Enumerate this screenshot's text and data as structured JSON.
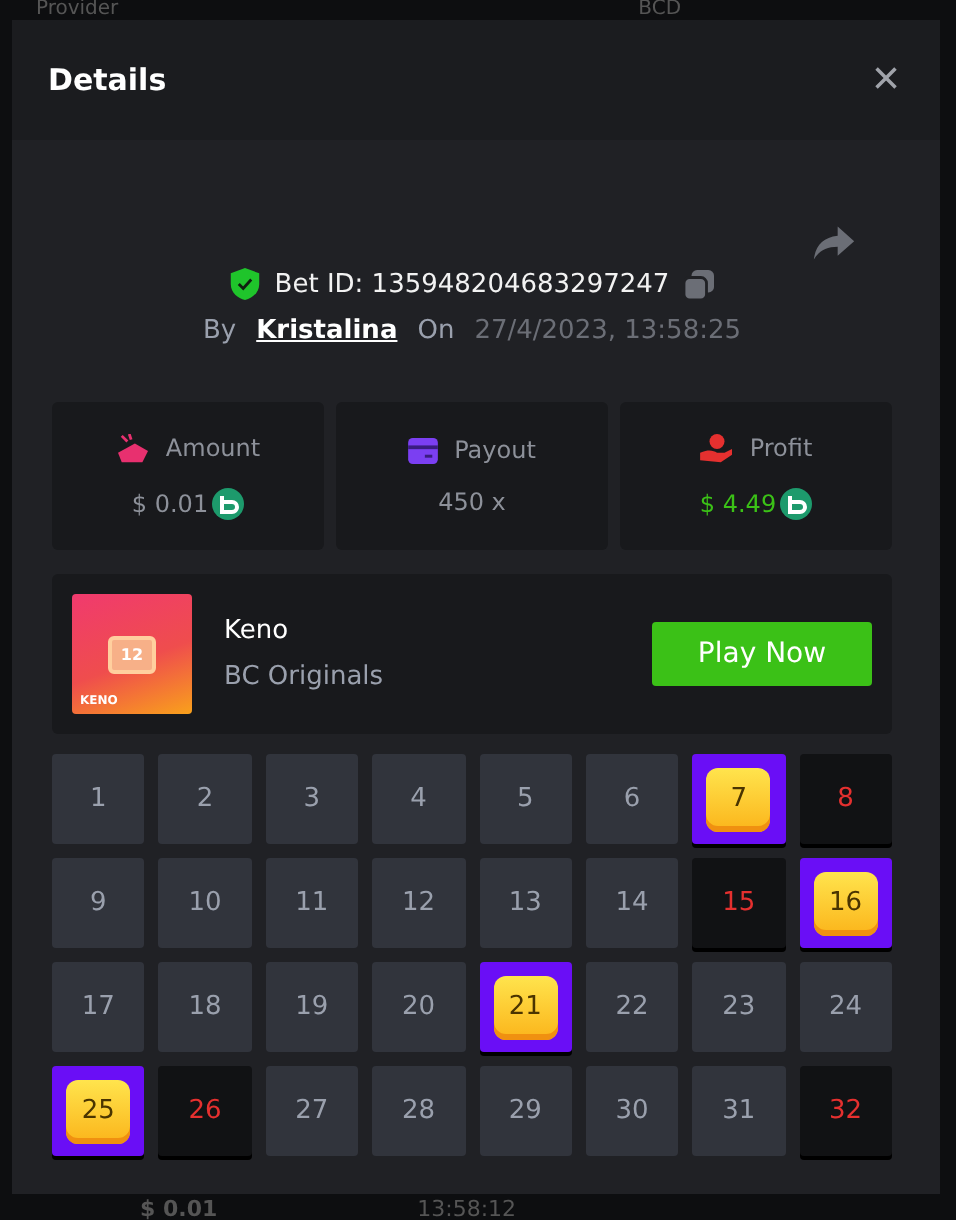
{
  "background": {
    "provider_label": "Provider",
    "currency": "BCD",
    "bottom_amount": "$ 0.01",
    "bottom_time": "13:58:12"
  },
  "dialog": {
    "title": "Details",
    "close": "×"
  },
  "bet": {
    "id_label": "Bet ID: 135948204683297247",
    "by_label": "By",
    "user": "Kristalina",
    "on_label": "On",
    "date": "27/4/2023, 13:58:25"
  },
  "stats": [
    {
      "kind": "amount",
      "label": "Amount",
      "value": "$ 0.01",
      "coin": true,
      "positive": false
    },
    {
      "kind": "payout",
      "label": "Payout",
      "value": "450 x",
      "coin": false,
      "positive": false
    },
    {
      "kind": "profit",
      "label": "Profit",
      "value": "$ 4.49",
      "coin": true,
      "positive": true
    }
  ],
  "game": {
    "thumb_number": "12",
    "thumb_label": "KENO",
    "name": "Keno",
    "provider": "BC Originals",
    "button": "Play Now"
  },
  "cells": [
    {
      "number": "1",
      "kind": "plain"
    },
    {
      "number": "2",
      "kind": "plain"
    },
    {
      "number": "3",
      "kind": "plain"
    },
    {
      "number": "4",
      "kind": "plain"
    },
    {
      "number": "5",
      "kind": "plain"
    },
    {
      "number": "6",
      "kind": "plain"
    },
    {
      "number": "7",
      "kind": "hit"
    },
    {
      "number": "8",
      "kind": "miss"
    },
    {
      "number": "9",
      "kind": "plain"
    },
    {
      "number": "10",
      "kind": "plain"
    },
    {
      "number": "11",
      "kind": "plain"
    },
    {
      "number": "12",
      "kind": "plain"
    },
    {
      "number": "13",
      "kind": "plain"
    },
    {
      "number": "14",
      "kind": "plain"
    },
    {
      "number": "15",
      "kind": "miss"
    },
    {
      "number": "16",
      "kind": "hit"
    },
    {
      "number": "17",
      "kind": "plain"
    },
    {
      "number": "18",
      "kind": "plain"
    },
    {
      "number": "19",
      "kind": "plain"
    },
    {
      "number": "20",
      "kind": "plain"
    },
    {
      "number": "21",
      "kind": "hit"
    },
    {
      "number": "22",
      "kind": "plain"
    },
    {
      "number": "23",
      "kind": "plain"
    },
    {
      "number": "24",
      "kind": "plain"
    },
    {
      "number": "25",
      "kind": "hit"
    },
    {
      "number": "26",
      "kind": "miss"
    },
    {
      "number": "27",
      "kind": "plain"
    },
    {
      "number": "28",
      "kind": "plain"
    },
    {
      "number": "29",
      "kind": "plain"
    },
    {
      "number": "30",
      "kind": "plain"
    },
    {
      "number": "31",
      "kind": "plain"
    },
    {
      "number": "32",
      "kind": "miss"
    }
  ]
}
